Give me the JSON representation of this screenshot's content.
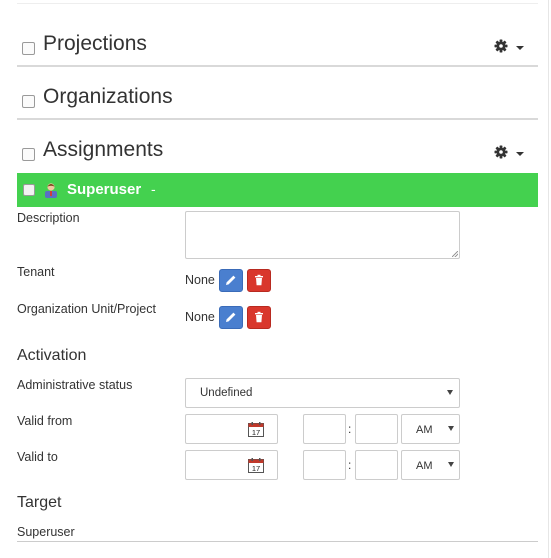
{
  "sections": {
    "projections": "Projections",
    "organizations": "Organizations",
    "assignments": "Assignments"
  },
  "assignment": {
    "name": "Superuser",
    "dash": "-"
  },
  "form": {
    "description_label": "Description",
    "tenant_label": "Tenant",
    "tenant_value": "None",
    "org_label": "Organization Unit/Project",
    "org_value": "None",
    "activation_heading": "Activation",
    "admin_status_label": "Administrative status",
    "admin_status_value": "Undefined",
    "valid_from_label": "Valid from",
    "valid_to_label": "Valid to",
    "ampm_value": "AM",
    "time_separator": ":",
    "target_heading": "Target",
    "target_value": "Superuser"
  },
  "colors": {
    "assignment_bar": "#44d14f",
    "edit_button": "#4a7fcf",
    "delete_button": "#d9372c"
  },
  "icons": {
    "gear": "gear-icon",
    "user": "user-icon",
    "edit": "pencil-icon",
    "delete": "trash-icon",
    "calendar": "calendar-icon"
  }
}
